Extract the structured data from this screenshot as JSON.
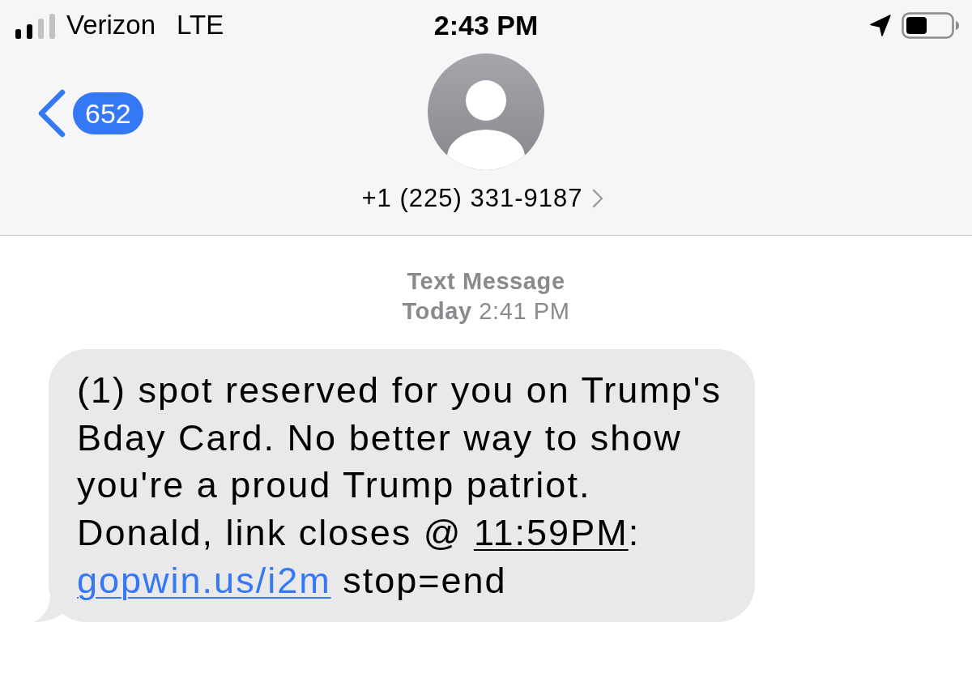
{
  "status_bar": {
    "carrier": "Verizon",
    "network": "LTE",
    "time": "2:43 PM"
  },
  "header": {
    "back_badge": "652",
    "contact": "+1 (225) 331-9187"
  },
  "thread": {
    "service": "Text Message",
    "timestamp": "**Today** 2:41 PM"
  },
  "messages": [
    {
      "kind": "incoming",
      "parts": [
        {
          "kind": "text",
          "text": "(1) spot reserved for you on Trump's Bday Card. No better way to show you're a proud Trump patriot.\nDonald, link closes @ "
        },
        {
          "kind": "date_link",
          "text": "11:59PM"
        },
        {
          "kind": "text",
          "text": ": "
        },
        {
          "kind": "url",
          "text": "gopwin.us/i2m"
        },
        {
          "kind": "text",
          "text": " stop=end"
        }
      ]
    }
  ]
}
